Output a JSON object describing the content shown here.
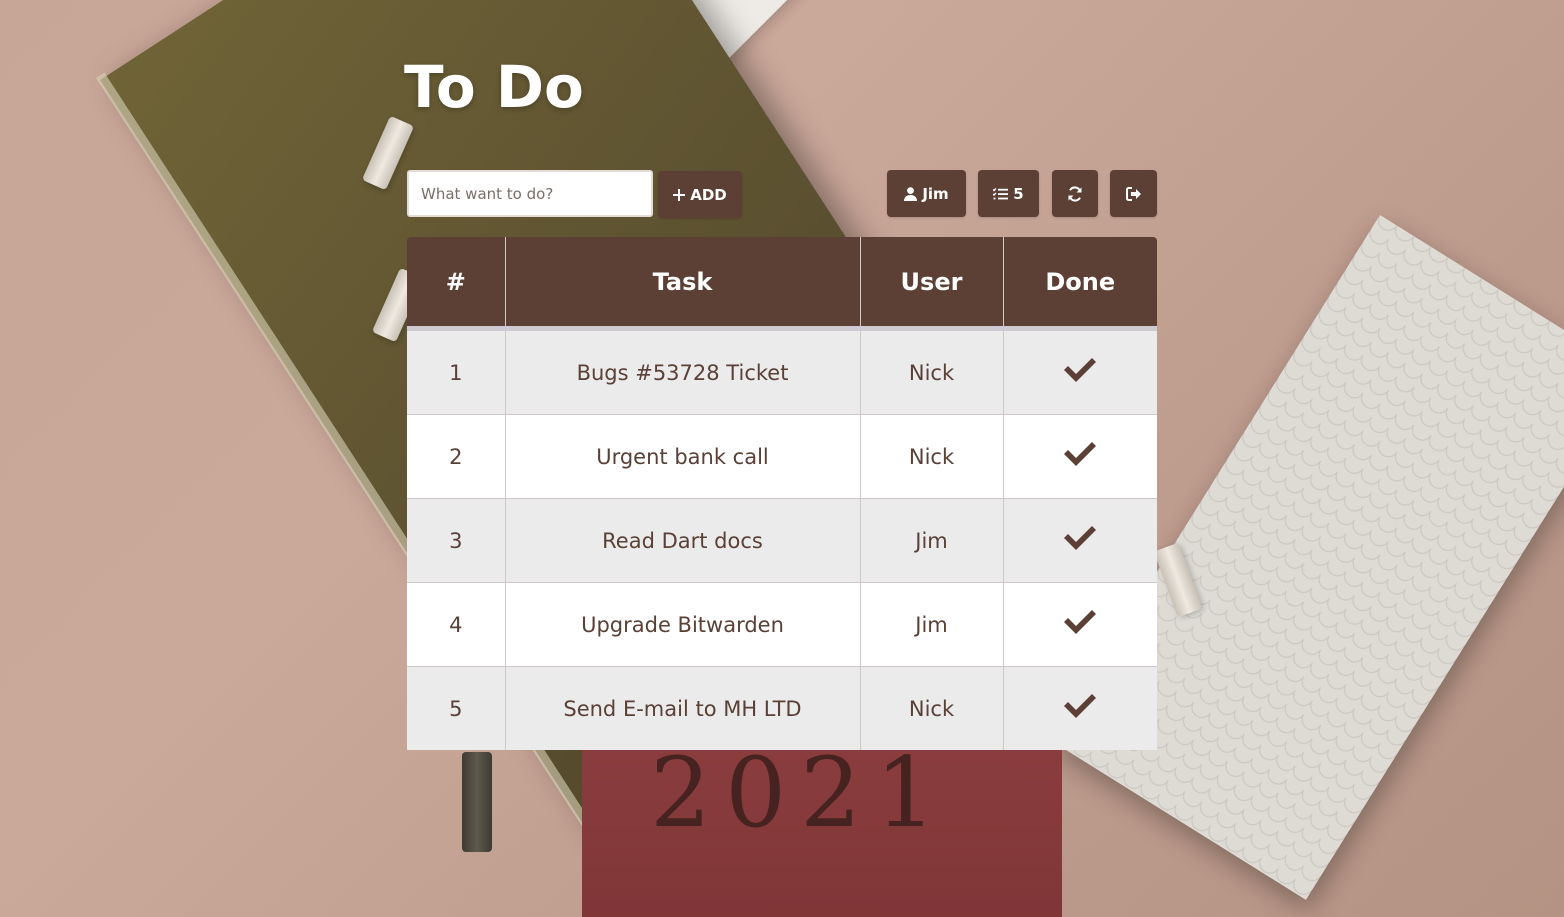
{
  "page": {
    "title": "To Do"
  },
  "toolbar": {
    "task_input_placeholder": "What want to do?",
    "task_input_value": "",
    "add_label": "ADD",
    "user_label": "Jim",
    "task_count": "5",
    "icons": {
      "add": "plus-icon",
      "user": "user-icon",
      "count": "list-icon",
      "refresh": "refresh-icon",
      "logout": "sign-out-icon"
    }
  },
  "table": {
    "headers": [
      "#",
      "Task",
      "User",
      "Done"
    ],
    "rows": [
      {
        "num": "1",
        "task": "Bugs #53728 Ticket",
        "user": "Nick",
        "done": true
      },
      {
        "num": "2",
        "task": "Urgent bank call",
        "user": "Nick",
        "done": true
      },
      {
        "num": "3",
        "task": "Read Dart docs",
        "user": "Jim",
        "done": true
      },
      {
        "num": "4",
        "task": "Upgrade Bitwarden",
        "user": "Jim",
        "done": true
      },
      {
        "num": "5",
        "task": "Send E-mail to MH LTD",
        "user": "Nick",
        "done": true
      }
    ]
  },
  "colors": {
    "brand": "#5c4036",
    "text": "#5a4036",
    "row_alt": "#ebebeb"
  }
}
